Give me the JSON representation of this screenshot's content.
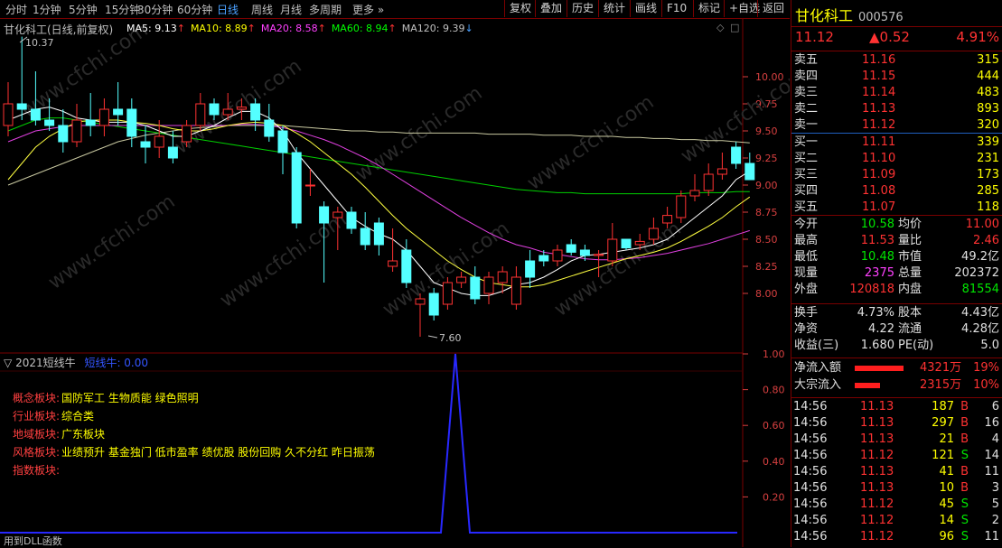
{
  "toolbar": {
    "left_items": [
      "分时",
      "1分钟",
      "5分钟",
      "15分钟",
      "30分钟",
      "60分钟",
      "日线",
      "周线",
      "月线",
      "多周期",
      "更多"
    ],
    "active_item": "日线",
    "right_items": [
      "复权",
      "叠加",
      "历史",
      "统计",
      "画线",
      "F10",
      "标记",
      "+自选",
      "返回"
    ]
  },
  "main_chart": {
    "title": "甘化科工(日线,前复权)",
    "ma_labels": [
      {
        "text": "MA5: 9.13",
        "color": "#ffffff"
      },
      {
        "text": "MA10: 8.89",
        "color": "#ffff00"
      },
      {
        "text": "MA20: 8.58",
        "color": "#ff40ff"
      },
      {
        "text": "MA60: 8.94",
        "color": "#00ff00"
      },
      {
        "text": "MA120: 9.39",
        "color": "#c0c0c0"
      }
    ],
    "high_marker": "10.37",
    "low_marker": "7.60",
    "y_ticks": [
      "10.00",
      "9.75",
      "9.50",
      "9.25",
      "9.00",
      "8.75",
      "8.50",
      "8.25",
      "8.00"
    ],
    "watermark": "www.cfchi.com"
  },
  "chart_data": {
    "type": "candlestick",
    "ylim": [
      7.5,
      10.5
    ],
    "candles": [
      {
        "o": 9.55,
        "h": 9.95,
        "l": 9.45,
        "c": 9.75
      },
      {
        "o": 9.75,
        "h": 10.37,
        "l": 9.6,
        "c": 9.7
      },
      {
        "o": 9.7,
        "h": 10.05,
        "l": 9.55,
        "c": 9.6
      },
      {
        "o": 9.6,
        "h": 9.8,
        "l": 9.5,
        "c": 9.55
      },
      {
        "o": 9.55,
        "h": 9.7,
        "l": 9.3,
        "c": 9.4
      },
      {
        "o": 9.4,
        "h": 9.75,
        "l": 9.35,
        "c": 9.6
      },
      {
        "o": 9.6,
        "h": 9.85,
        "l": 9.45,
        "c": 9.55
      },
      {
        "o": 9.55,
        "h": 9.8,
        "l": 9.45,
        "c": 9.7
      },
      {
        "o": 9.7,
        "h": 9.95,
        "l": 9.55,
        "c": 9.65
      },
      {
        "o": 9.7,
        "h": 9.8,
        "l": 9.35,
        "c": 9.45
      },
      {
        "o": 9.4,
        "h": 9.55,
        "l": 9.2,
        "c": 9.35
      },
      {
        "o": 9.35,
        "h": 9.6,
        "l": 9.25,
        "c": 9.45
      },
      {
        "o": 9.35,
        "h": 9.5,
        "l": 9.2,
        "c": 9.25
      },
      {
        "o": 9.4,
        "h": 9.6,
        "l": 9.35,
        "c": 9.55
      },
      {
        "o": 9.55,
        "h": 9.85,
        "l": 9.5,
        "c": 9.75
      },
      {
        "o": 9.75,
        "h": 9.8,
        "l": 9.6,
        "c": 9.65
      },
      {
        "o": 9.65,
        "h": 9.85,
        "l": 9.6,
        "c": 9.7
      },
      {
        "o": 9.7,
        "h": 9.8,
        "l": 9.6,
        "c": 9.72
      },
      {
        "o": 9.75,
        "h": 9.8,
        "l": 9.5,
        "c": 9.6
      },
      {
        "o": 9.6,
        "h": 9.75,
        "l": 9.4,
        "c": 9.45
      },
      {
        "o": 9.5,
        "h": 9.55,
        "l": 9.1,
        "c": 9.3
      },
      {
        "o": 9.3,
        "h": 9.35,
        "l": 8.6,
        "c": 8.65
      },
      {
        "o": 9.0,
        "h": 9.15,
        "l": 8.9,
        "c": 9.0
      },
      {
        "o": 8.8,
        "h": 8.85,
        "l": 8.1,
        "c": 8.65
      },
      {
        "o": 8.7,
        "h": 8.8,
        "l": 8.4,
        "c": 8.75
      },
      {
        "o": 8.75,
        "h": 8.8,
        "l": 8.55,
        "c": 8.6
      },
      {
        "o": 8.6,
        "h": 8.75,
        "l": 8.4,
        "c": 8.45
      },
      {
        "o": 8.65,
        "h": 8.7,
        "l": 8.35,
        "c": 8.45
      },
      {
        "o": 8.25,
        "h": 8.6,
        "l": 8.2,
        "c": 8.3
      },
      {
        "o": 8.4,
        "h": 8.5,
        "l": 8.05,
        "c": 8.1
      },
      {
        "o": 7.9,
        "h": 8.0,
        "l": 7.6,
        "c": 7.95
      },
      {
        "o": 8.0,
        "h": 8.05,
        "l": 7.75,
        "c": 7.8
      },
      {
        "o": 7.9,
        "h": 8.15,
        "l": 7.85,
        "c": 8.1
      },
      {
        "o": 8.1,
        "h": 8.2,
        "l": 8.05,
        "c": 8.15
      },
      {
        "o": 8.15,
        "h": 8.25,
        "l": 7.9,
        "c": 7.95
      },
      {
        "o": 8.0,
        "h": 8.2,
        "l": 7.9,
        "c": 8.15
      },
      {
        "o": 8.1,
        "h": 8.25,
        "l": 8.0,
        "c": 8.2
      },
      {
        "o": 7.9,
        "h": 8.25,
        "l": 7.85,
        "c": 8.15
      },
      {
        "o": 8.3,
        "h": 8.4,
        "l": 8.05,
        "c": 8.15
      },
      {
        "o": 8.35,
        "h": 8.4,
        "l": 8.25,
        "c": 8.3
      },
      {
        "o": 8.3,
        "h": 8.45,
        "l": 8.25,
        "c": 8.4
      },
      {
        "o": 8.45,
        "h": 8.5,
        "l": 8.35,
        "c": 8.38
      },
      {
        "o": 8.4,
        "h": 8.45,
        "l": 8.3,
        "c": 8.35
      },
      {
        "o": 8.35,
        "h": 8.4,
        "l": 8.15,
        "c": 8.36
      },
      {
        "o": 8.3,
        "h": 8.65,
        "l": 8.25,
        "c": 8.5
      },
      {
        "o": 8.5,
        "h": 8.5,
        "l": 8.4,
        "c": 8.42
      },
      {
        "o": 8.45,
        "h": 8.55,
        "l": 8.4,
        "c": 8.48
      },
      {
        "o": 8.5,
        "h": 8.7,
        "l": 8.45,
        "c": 8.6
      },
      {
        "o": 8.65,
        "h": 8.8,
        "l": 8.6,
        "c": 8.72
      },
      {
        "o": 8.7,
        "h": 8.95,
        "l": 8.65,
        "c": 8.9
      },
      {
        "o": 8.9,
        "h": 9.1,
        "l": 8.85,
        "c": 8.95
      },
      {
        "o": 8.95,
        "h": 9.2,
        "l": 8.9,
        "c": 9.1
      },
      {
        "o": 9.1,
        "h": 9.3,
        "l": 9.05,
        "c": 9.15
      },
      {
        "o": 9.35,
        "h": 9.4,
        "l": 9.15,
        "c": 9.2
      },
      {
        "o": 9.2,
        "h": 9.3,
        "l": 9.05,
        "c": 9.05
      }
    ],
    "ma5": [
      9.6,
      9.65,
      9.7,
      9.72,
      9.68,
      9.62,
      9.6,
      9.58,
      9.58,
      9.58,
      9.55,
      9.5,
      9.45,
      9.45,
      9.5,
      9.55,
      9.62,
      9.68,
      9.68,
      9.62,
      9.5,
      9.3,
      9.15,
      9.0,
      8.85,
      8.7,
      8.62,
      8.55,
      8.5,
      8.4,
      8.25,
      8.1,
      8.05,
      8.0,
      7.98,
      7.98,
      8.02,
      8.08,
      8.1,
      8.15,
      8.22,
      8.3,
      8.35,
      8.36,
      8.38,
      8.4,
      8.42,
      8.45,
      8.5,
      8.6,
      8.7,
      8.8,
      8.9,
      9.05,
      9.13
    ],
    "ma10": [
      9.05,
      9.2,
      9.35,
      9.45,
      9.52,
      9.58,
      9.6,
      9.6,
      9.6,
      9.58,
      9.57,
      9.55,
      9.52,
      9.5,
      9.5,
      9.52,
      9.55,
      9.57,
      9.58,
      9.57,
      9.55,
      9.48,
      9.4,
      9.3,
      9.2,
      9.1,
      8.98,
      8.85,
      8.72,
      8.6,
      8.5,
      8.4,
      8.3,
      8.22,
      8.15,
      8.1,
      8.08,
      8.06,
      8.06,
      8.08,
      8.12,
      8.16,
      8.2,
      8.24,
      8.28,
      8.32,
      8.35,
      8.38,
      8.42,
      8.48,
      8.55,
      8.62,
      8.7,
      8.8,
      8.89
    ],
    "ma20": [
      9.4,
      9.45,
      9.5,
      9.52,
      9.54,
      9.55,
      9.55,
      9.55,
      9.55,
      9.55,
      9.55,
      9.55,
      9.55,
      9.55,
      9.55,
      9.55,
      9.55,
      9.56,
      9.56,
      9.55,
      9.53,
      9.5,
      9.46,
      9.42,
      9.37,
      9.31,
      9.25,
      9.18,
      9.1,
      9.02,
      8.94,
      8.86,
      8.78,
      8.7,
      8.63,
      8.56,
      8.5,
      8.45,
      8.42,
      8.38,
      8.36,
      8.34,
      8.32,
      8.31,
      8.31,
      8.32,
      8.33,
      8.35,
      8.37,
      8.4,
      8.43,
      8.46,
      8.5,
      8.54,
      8.58
    ],
    "ma60": [
      9.5,
      9.55,
      9.6,
      9.62,
      9.62,
      9.6,
      9.58,
      9.56,
      9.54,
      9.52,
      9.5,
      9.48,
      9.46,
      9.44,
      9.42,
      9.4,
      9.38,
      9.36,
      9.34,
      9.32,
      9.3,
      9.28,
      9.26,
      9.24,
      9.22,
      9.2,
      9.18,
      9.16,
      9.14,
      9.12,
      9.1,
      9.08,
      9.06,
      9.04,
      9.02,
      9.0,
      8.98,
      8.96,
      8.95,
      8.94,
      8.93,
      8.93,
      8.92,
      8.92,
      8.92,
      8.92,
      8.92,
      8.92,
      8.92,
      8.92,
      8.93,
      8.93,
      8.93,
      8.94,
      8.94
    ],
    "ma120": [
      9.0,
      9.05,
      9.1,
      9.15,
      9.2,
      9.25,
      9.3,
      9.35,
      9.4,
      9.43,
      9.46,
      9.48,
      9.5,
      9.52,
      9.53,
      9.54,
      9.55,
      9.55,
      9.55,
      9.55,
      9.55,
      9.54,
      9.53,
      9.52,
      9.51,
      9.5,
      9.5,
      9.49,
      9.49,
      9.48,
      9.48,
      9.48,
      9.48,
      9.48,
      9.48,
      9.47,
      9.47,
      9.47,
      9.47,
      9.46,
      9.46,
      9.46,
      9.45,
      9.45,
      9.45,
      9.44,
      9.44,
      9.43,
      9.43,
      9.42,
      9.42,
      9.41,
      9.41,
      9.4,
      9.39
    ]
  },
  "sub_chart": {
    "title": "2021短线牛",
    "series_label": "短线牛: 0.00",
    "y_ticks": [
      "1.00",
      "0.80",
      "0.60",
      "0.40",
      "0.20"
    ],
    "footer": "用到DLL函数",
    "info": [
      {
        "key": "概念板块:",
        "value": "国防军工 生物质能 绿色照明"
      },
      {
        "key": "行业板块:",
        "value": "综合类"
      },
      {
        "key": "地域板块:",
        "value": "广东板块"
      },
      {
        "key": "风格板块:",
        "value": "业绩预升 基金独门 低市盈率 绩优股 股份回购 久不分红 昨日振荡"
      },
      {
        "key": "指数板块:",
        "value": ""
      }
    ],
    "signal": {
      "values": [
        0,
        1,
        0
      ],
      "ylim": [
        0,
        1.05
      ]
    }
  },
  "quote": {
    "name": "甘化科工",
    "code": "000576",
    "price": "11.12",
    "change": "▲0.52",
    "change_pct": "4.91%",
    "asks": [
      {
        "label": "卖五",
        "price": "11.16",
        "vol": "315"
      },
      {
        "label": "卖四",
        "price": "11.15",
        "vol": "444"
      },
      {
        "label": "卖三",
        "price": "11.14",
        "vol": "483"
      },
      {
        "label": "卖二",
        "price": "11.13",
        "vol": "893"
      },
      {
        "label": "卖一",
        "price": "11.12",
        "vol": "320"
      }
    ],
    "bids": [
      {
        "label": "买一",
        "price": "11.11",
        "vol": "339"
      },
      {
        "label": "买二",
        "price": "11.10",
        "vol": "231"
      },
      {
        "label": "买三",
        "price": "11.09",
        "vol": "173"
      },
      {
        "label": "买四",
        "price": "11.08",
        "vol": "285"
      },
      {
        "label": "买五",
        "price": "11.07",
        "vol": "118"
      }
    ],
    "stats": [
      {
        "k1": "今开",
        "v1": "10.58",
        "c1": "green",
        "k2": "均价",
        "v2": "11.00",
        "c2": "red"
      },
      {
        "k1": "最高",
        "v1": "11.53",
        "c1": "red",
        "k2": "量比",
        "v2": "2.46",
        "c2": "red"
      },
      {
        "k1": "最低",
        "v1": "10.48",
        "c1": "green",
        "k2": "市值",
        "v2": "49.2亿",
        "c2": "white"
      },
      {
        "k1": "现量",
        "v1": "2375",
        "c1": "magenta",
        "k2": "总量",
        "v2": "202372",
        "c2": "white"
      },
      {
        "k1": "外盘",
        "v1": "120818",
        "c1": "red",
        "k2": "内盘",
        "v2": "81554",
        "c2": "green"
      }
    ],
    "stats2": [
      {
        "k1": "换手",
        "v1": "4.73%",
        "k2": "股本",
        "v2": "4.43亿"
      },
      {
        "k1": "净资",
        "v1": "4.22",
        "k2": "流通",
        "v2": "4.28亿"
      },
      {
        "k1": "收益(三)",
        "v1": "1.680",
        "k2": "PE(动)",
        "v2": "5.0"
      }
    ],
    "flows": [
      {
        "label": "净流入额",
        "amount": "4321万",
        "pct": "19%",
        "bar": 0.19
      },
      {
        "label": "大宗流入",
        "amount": "2315万",
        "pct": "10%",
        "bar": 0.1
      }
    ],
    "ticks": [
      {
        "time": "14:56",
        "price": "11.13",
        "vol": "187",
        "side": "B",
        "count": "6"
      },
      {
        "time": "14:56",
        "price": "11.13",
        "vol": "297",
        "side": "B",
        "count": "16"
      },
      {
        "time": "14:56",
        "price": "11.13",
        "vol": "21",
        "side": "B",
        "count": "4"
      },
      {
        "time": "14:56",
        "price": "11.12",
        "vol": "121",
        "side": "S",
        "count": "14"
      },
      {
        "time": "14:56",
        "price": "11.13",
        "vol": "41",
        "side": "B",
        "count": "11"
      },
      {
        "time": "14:56",
        "price": "11.13",
        "vol": "10",
        "side": "B",
        "count": "3"
      },
      {
        "time": "14:56",
        "price": "11.12",
        "vol": "45",
        "side": "S",
        "count": "5"
      },
      {
        "time": "14:56",
        "price": "11.12",
        "vol": "14",
        "side": "S",
        "count": "2"
      },
      {
        "time": "14:56",
        "price": "11.12",
        "vol": "96",
        "side": "S",
        "count": "11"
      }
    ]
  }
}
